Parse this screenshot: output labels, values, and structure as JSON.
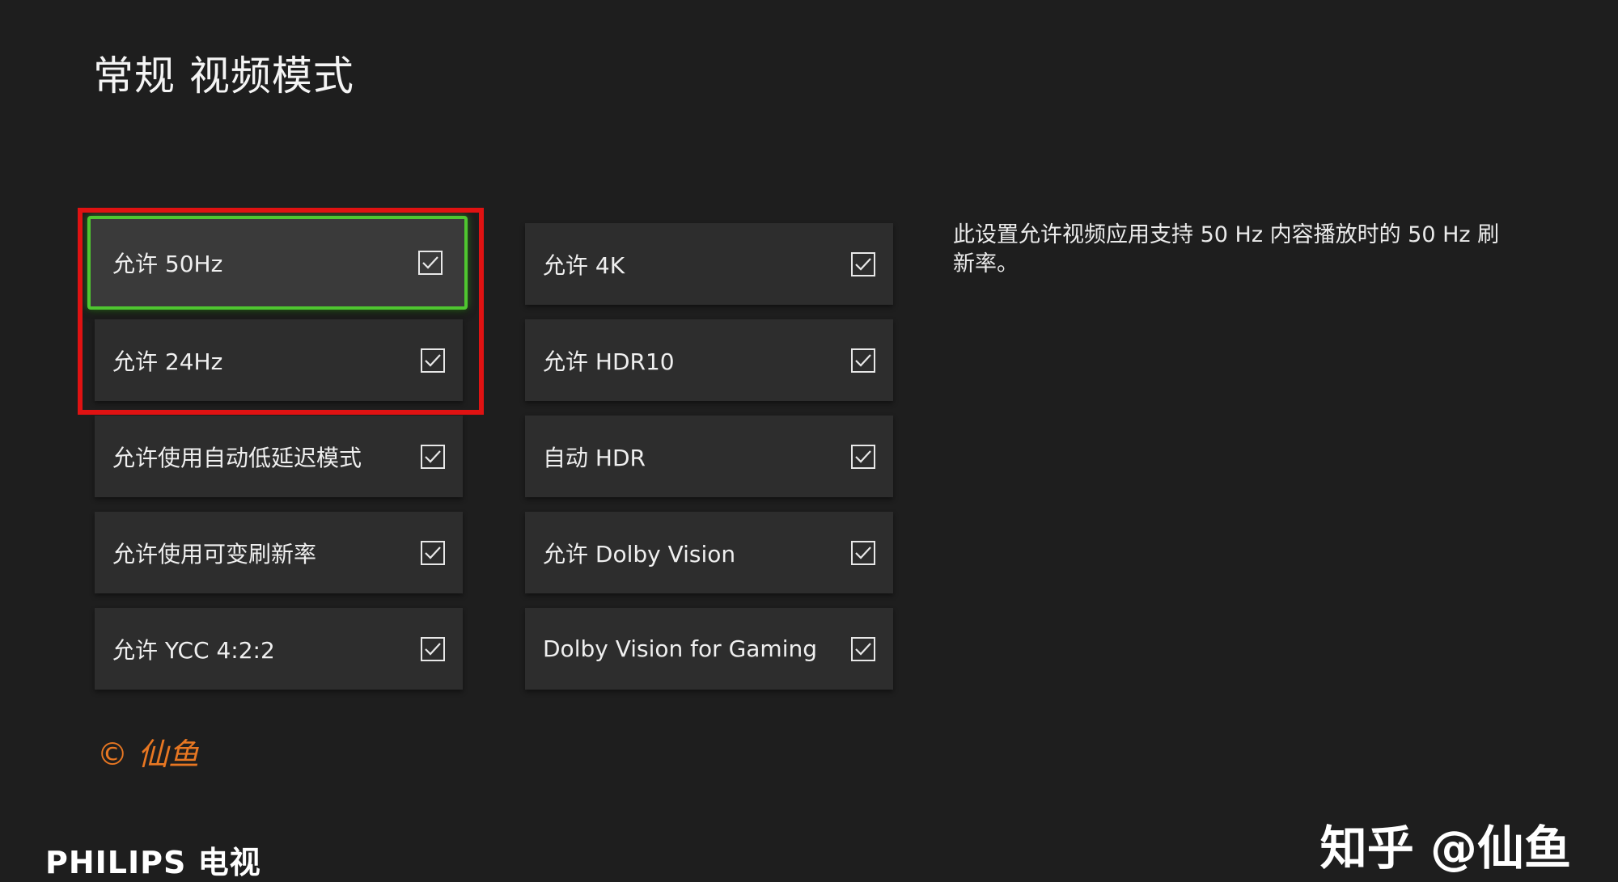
{
  "header": {
    "title": "常规  视频模式"
  },
  "settings": {
    "left": [
      {
        "label": "允许 50Hz",
        "checked": true,
        "focused": true
      },
      {
        "label": "允许 24Hz",
        "checked": true
      },
      {
        "label": "允许使用自动低延迟模式",
        "checked": true
      },
      {
        "label": "允许使用可变刷新率",
        "checked": true
      },
      {
        "label": "允许 YCC 4:2:2",
        "checked": true
      }
    ],
    "right": [
      {
        "label": "允许 4K",
        "checked": true
      },
      {
        "label": "允许 HDR10",
        "checked": true
      },
      {
        "label": "自动 HDR",
        "checked": true
      },
      {
        "label": "允许 Dolby Vision",
        "checked": true
      },
      {
        "label": "Dolby Vision for Gaming",
        "checked": true
      }
    ]
  },
  "description": "此设置允许视频应用支持 50 Hz 内容播放时的 50 Hz 刷新率。",
  "overlay": {
    "copyright": "© 仙鱼",
    "brand": "PHILIPS 电视",
    "zhihu": "知乎 @仙鱼",
    "highlight_color": "#e01212",
    "focus_color": "#4fc630"
  },
  "icons": {
    "checkbox": "checkbox-checked-icon"
  }
}
